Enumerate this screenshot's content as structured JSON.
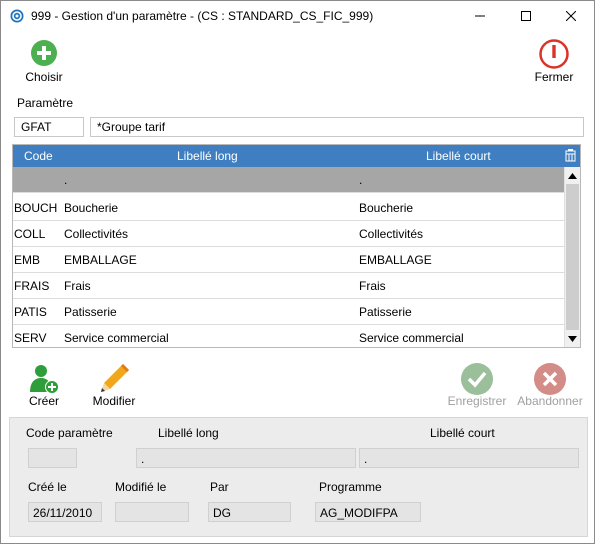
{
  "window": {
    "title": "999 - Gestion d'un paramètre - (CS : STANDARD_CS_FIC_999)"
  },
  "toolbar": {
    "choose_label": "Choisir",
    "close_label": "Fermer"
  },
  "parameter": {
    "section_label": "Paramètre",
    "code": "GFAT",
    "name": "*Groupe tarif"
  },
  "grid": {
    "columns": [
      "Code",
      "Libellé long",
      "Libellé court"
    ],
    "rows": [
      {
        "code": "",
        "long": ".",
        "short": "."
      },
      {
        "code": "BOUCH",
        "long": "Boucherie",
        "short": "Boucherie"
      },
      {
        "code": "COLL",
        "long": "Collectivités",
        "short": "Collectivités"
      },
      {
        "code": "EMB",
        "long": "EMBALLAGE",
        "short": "EMBALLAGE"
      },
      {
        "code": "FRAIS",
        "long": "Frais",
        "short": "Frais"
      },
      {
        "code": "PATIS",
        "long": "Patisserie",
        "short": "Patisserie"
      },
      {
        "code": "SERV",
        "long": "Service commercial",
        "short": "Service commercial"
      }
    ]
  },
  "actions": {
    "create_label": "Créer",
    "modify_label": "Modifier",
    "save_label": "Enregistrer",
    "cancel_label": "Abandonner"
  },
  "detail": {
    "code_label": "Code paramètre",
    "long_label": "Libellé long",
    "short_label": "Libellé court",
    "code_value": "",
    "long_value": ".",
    "short_value": ".",
    "created_label": "Créé le",
    "modified_label": "Modifié le",
    "by_label": "Par",
    "program_label": "Programme",
    "created_value": "26/11/2010",
    "modified_value": "",
    "by_value": "DG",
    "program_value": "AG_MODIFPA"
  },
  "colors": {
    "header_blue": "#3f7fc1",
    "selected_row": "#a6a6a6",
    "add_green": "#4caf50",
    "close_red": "#d9342b"
  }
}
